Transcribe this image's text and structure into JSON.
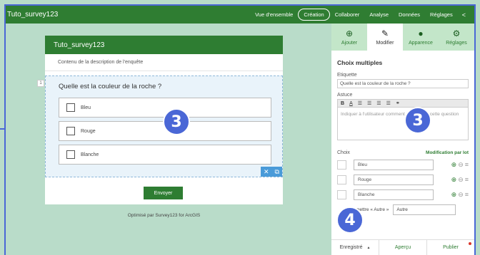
{
  "header": {
    "title": "Tuto_survey123",
    "nav": [
      "Vue d'ensemble",
      "Création",
      "Collaborer",
      "Analyse",
      "Données",
      "Réglages"
    ],
    "active_nav": "Création",
    "share_icon": "share-icon"
  },
  "form": {
    "title": "Tuto_survey123",
    "description": "Contenu de la description de l'enquête",
    "question_number": "1",
    "question": "Quelle est la couleur de la roche ?",
    "options": [
      "Bleu",
      "Rouge",
      "Blanche"
    ],
    "submit": "Envoyer",
    "powered_by": "Optimisé par Survey123 for ArcGIS"
  },
  "panel": {
    "tabs": [
      {
        "label": "Ajouter",
        "icon": "add-icon"
      },
      {
        "label": "Modifier",
        "icon": "pencil-icon"
      },
      {
        "label": "Apparence",
        "icon": "palette-icon"
      },
      {
        "label": "Réglages",
        "icon": "settings-icon"
      }
    ],
    "active_tab": "Modifier",
    "section_title": "Choix multiples",
    "label_field": "Etiquette",
    "label_value": "Quelle est la couleur de la roche ?",
    "hint_field": "Astuce",
    "hint_placeholder": "Indiquer à l'utilisateur comment répondre à cette question",
    "choices_label": "Choix",
    "batch_edit": "Modification par lot",
    "choices": [
      "Bleu",
      "Rouge",
      "Blanche"
    ],
    "other_label": "Permettre « Autre »",
    "other_value": "Autre",
    "footer": {
      "saved": "Enregistré",
      "preview": "Aperçu",
      "publish": "Publier"
    }
  },
  "badges": [
    "3",
    "3",
    "4"
  ],
  "colors": {
    "primary_green": "#2e7d32",
    "annotation_blue": "#4a67d6",
    "canvas_bg": "#b9dcc9"
  }
}
